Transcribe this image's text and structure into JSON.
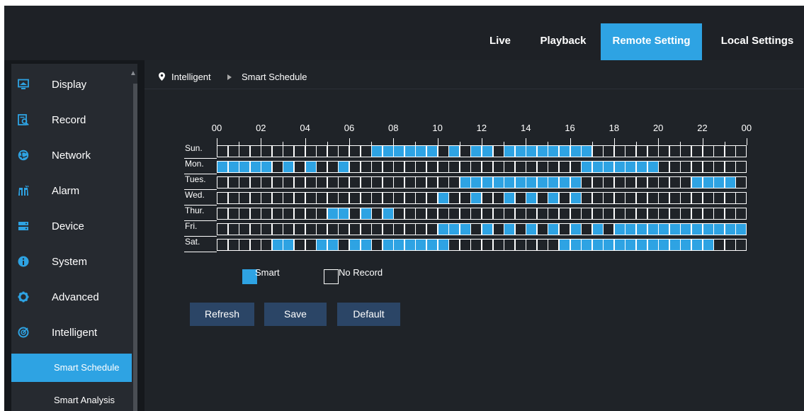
{
  "nav": {
    "tabs": [
      {
        "label": "Live"
      },
      {
        "label": "Playback"
      },
      {
        "label": "Remote Setting"
      },
      {
        "label": "Local Settings"
      }
    ],
    "active": 2
  },
  "sidebar": {
    "items": [
      {
        "label": "Display",
        "icon": "display-icon"
      },
      {
        "label": "Record",
        "icon": "record-icon"
      },
      {
        "label": "Network",
        "icon": "network-icon"
      },
      {
        "label": "Alarm",
        "icon": "alarm-icon"
      },
      {
        "label": "Device",
        "icon": "device-icon"
      },
      {
        "label": "System",
        "icon": "system-icon"
      },
      {
        "label": "Advanced",
        "icon": "advanced-icon"
      },
      {
        "label": "Intelligent",
        "icon": "intelligent-icon"
      }
    ],
    "sub_items": [
      {
        "label": "Smart Schedule",
        "active": true
      },
      {
        "label": "Smart Analysis",
        "active": false
      }
    ]
  },
  "breadcrumb": {
    "section": "Intelligent",
    "page": "Smart Schedule"
  },
  "schedule": {
    "hours": [
      "00",
      "02",
      "04",
      "06",
      "08",
      "10",
      "12",
      "14",
      "16",
      "18",
      "20",
      "22",
      "00"
    ],
    "days": [
      {
        "label": "Sun.",
        "on": [
          14,
          15,
          16,
          17,
          18,
          19,
          21,
          23,
          24,
          26,
          27,
          28,
          29,
          30,
          31,
          32,
          33
        ]
      },
      {
        "label": "Mon.",
        "on": [
          0,
          1,
          2,
          3,
          4,
          6,
          8,
          11,
          33,
          34,
          35,
          36,
          37,
          38,
          39
        ]
      },
      {
        "label": "Tues.",
        "on": [
          22,
          23,
          24,
          25,
          26,
          27,
          28,
          29,
          30,
          31,
          32,
          43,
          44,
          45,
          46
        ]
      },
      {
        "label": "Wed.",
        "on": [
          20,
          23,
          26,
          28,
          30,
          32
        ]
      },
      {
        "label": "Thur.",
        "on": [
          10,
          11,
          13,
          15
        ]
      },
      {
        "label": "Fri.",
        "on": [
          20,
          21,
          22,
          24,
          26,
          28,
          30,
          32,
          34,
          36,
          37,
          38,
          39,
          40,
          41,
          42,
          43,
          44,
          45,
          46,
          47
        ]
      },
      {
        "label": "Sat.",
        "on": [
          5,
          6,
          9,
          10,
          12,
          13,
          15,
          16,
          17,
          18,
          19,
          20,
          31,
          32,
          33,
          34,
          35,
          36,
          37,
          38,
          39,
          40,
          41,
          42,
          43,
          44
        ]
      }
    ],
    "colors": {
      "smart": "#2ea3e3",
      "none": "#1f2328"
    }
  },
  "legend": {
    "smart": "Smart",
    "none": "No Record"
  },
  "buttons": {
    "refresh": "Refresh",
    "save": "Save",
    "default": "Default"
  },
  "theme": {
    "accent": "#2ea3e3",
    "button": "#2b4566"
  }
}
